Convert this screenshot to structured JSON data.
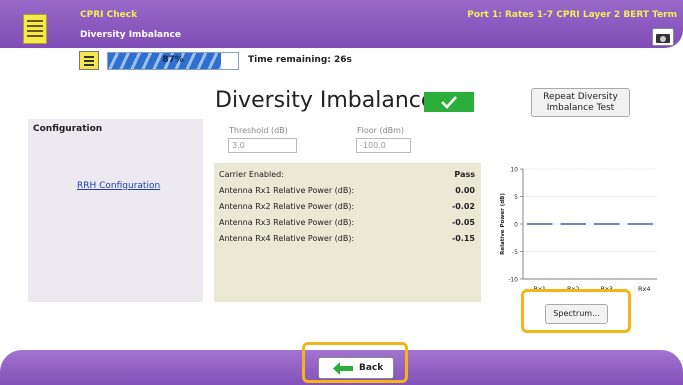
{
  "header": {
    "app_title": "CPRI Check",
    "subtitle": "Diversity Imbalance",
    "port_info": "Port 1: Rates 1-7 CPRI Layer 2 BERT Term"
  },
  "progress": {
    "percent_text": "87%",
    "fraction": 0.87,
    "time_remaining": "Time remaining: 26s"
  },
  "main": {
    "title": "Diversity Imbalance:",
    "status": "pass",
    "repeat_button": "Repeat Diversity Imbalance Test"
  },
  "config": {
    "title": "Configuration",
    "rrh_link": "RRH Configuration",
    "threshold_label": "Threshold (dB)",
    "threshold_value": "3.0",
    "floor_label": "Floor (dBm)",
    "floor_value": "-100.0"
  },
  "results": [
    {
      "label": "Carrier Enabled:",
      "value": "Pass"
    },
    {
      "label": "Antenna Rx1 Relative Power (dB):",
      "value": "0.00"
    },
    {
      "label": "Antenna Rx2 Relative Power (dB):",
      "value": "-0.02"
    },
    {
      "label": "Antenna Rx3 Relative Power (dB):",
      "value": "-0.05"
    },
    {
      "label": "Antenna Rx4 Relative Power (dB):",
      "value": "-0.15"
    }
  ],
  "chart_data": {
    "type": "bar",
    "categories": [
      "Rx1",
      "Rx2",
      "Rx3",
      "Rx4"
    ],
    "values": [
      0.0,
      -0.02,
      -0.05,
      -0.15
    ],
    "ylabel": "Relative Power (dB)",
    "ylim": [
      -10,
      10
    ],
    "yticks": [
      "10",
      "5",
      "0",
      "-5",
      "-10"
    ],
    "grid": true,
    "color": "#3a4fb0"
  },
  "buttons": {
    "spectrum": "Spectrum...",
    "back": "Back"
  },
  "colors": {
    "header_purple": "#8a57bd",
    "accent_yellow": "#f7ec5a",
    "pass_green": "#2cae3a",
    "highlight_orange": "#f4b51c"
  }
}
